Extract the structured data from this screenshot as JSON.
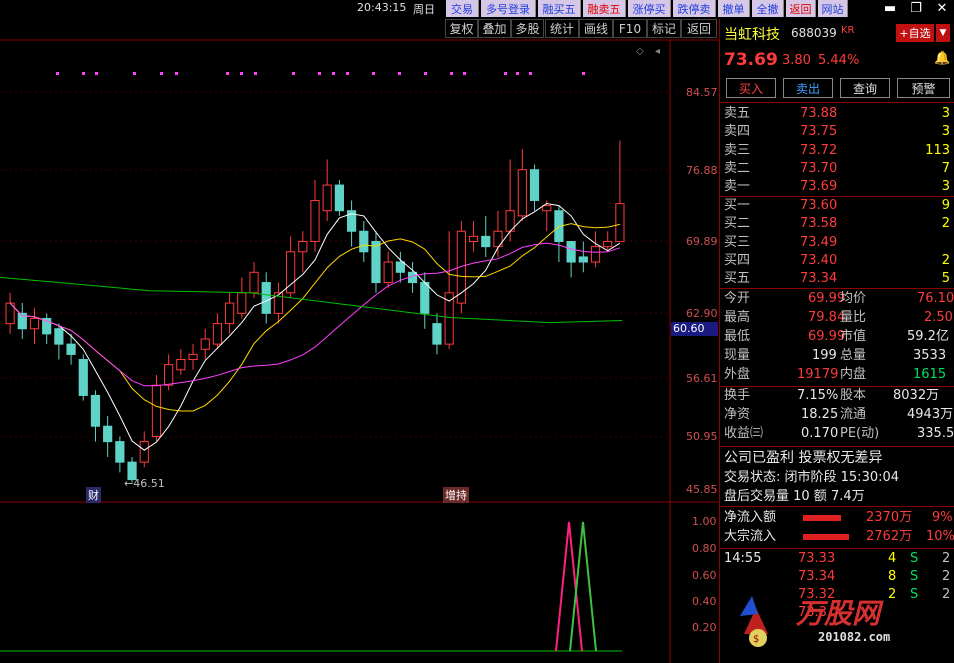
{
  "topbar": {
    "clock": "20:43:15",
    "weekday": "周日",
    "buttons": [
      "交易",
      "多号登录",
      "融买五",
      "融卖五",
      "涨停买",
      "跌停卖",
      "撤单",
      "全撤",
      "返回",
      "网站"
    ],
    "window_controls": [
      "▬",
      "❐",
      "✕"
    ]
  },
  "toolbar": {
    "buttons": [
      "复权",
      "叠加",
      "多股",
      "统计",
      "画线",
      "F10",
      "标记",
      "返回"
    ]
  },
  "chart": {
    "price_ticks": [
      "84.57",
      "76.88",
      "69.89",
      "62.90",
      "56.61",
      "50.95",
      "45.85"
    ],
    "current_marker": "60.60",
    "low_label": "←46.51",
    "tag_cai": "财",
    "tag_zengchi": "增持",
    "sub_ticks": [
      "1.00",
      "0.80",
      "0.60",
      "0.40",
      "0.20"
    ]
  },
  "stock": {
    "name": "当虹科技",
    "code": "688039",
    "suffix": "KR",
    "add_fav": "+自选",
    "price": "73.69",
    "change": "3.80",
    "change_pct": "5.44%",
    "actions": [
      "买入",
      "卖出",
      "查询",
      "预警"
    ]
  },
  "order_book": {
    "sell": [
      {
        "label": "卖五",
        "price": "73.88",
        "vol": "3"
      },
      {
        "label": "卖四",
        "price": "73.75",
        "vol": "3"
      },
      {
        "label": "卖三",
        "price": "73.72",
        "vol": "113"
      },
      {
        "label": "卖二",
        "price": "73.70",
        "vol": "7"
      },
      {
        "label": "卖一",
        "price": "73.69",
        "vol": "3"
      }
    ],
    "buy": [
      {
        "label": "买一",
        "price": "73.60",
        "vol": "9"
      },
      {
        "label": "买二",
        "price": "73.58",
        "vol": "2"
      },
      {
        "label": "买三",
        "price": "73.49",
        "vol": ""
      },
      {
        "label": "买四",
        "price": "73.40",
        "vol": "2"
      },
      {
        "label": "买五",
        "price": "73.34",
        "vol": "5"
      }
    ]
  },
  "stats": {
    "open_l": "今开",
    "open": "69.99",
    "avg_l": "均价",
    "avg": "76.10",
    "high_l": "最高",
    "high": "79.84",
    "ratio_l": "量比",
    "ratio": "2.50",
    "low_l": "最低",
    "low": "69.99",
    "mcap_l": "市值",
    "mcap": "59.2亿",
    "cur_l": "现量",
    "cur": "199",
    "total_l": "总量",
    "total": "3533",
    "out_l": "外盘",
    "out": "19179",
    "in_l": "内盘",
    "in": "1615",
    "turn_l": "换手",
    "turn": "7.15%",
    "shares_l": "股本",
    "shares": "8032万",
    "nav_l": "净资",
    "nav": "18.25",
    "float_l": "流通",
    "float": "4943万",
    "eps_l": "收益㈢",
    "eps": "0.170",
    "pe_l": "PE(动)",
    "pe": "335.5"
  },
  "info": {
    "line1": "公司已盈利 投票权无差异",
    "line2": "交易状态: 闭市阶段 15:30:04",
    "line3": "盘后交易量 10 额 7.4万",
    "net_inflow_l": "净流入额",
    "net_inflow": "2370万",
    "net_inflow_pct": "9%",
    "big_inflow_l": "大宗流入",
    "big_inflow": "2762万",
    "big_inflow_pct": "10%"
  },
  "ticks": [
    {
      "time": "14:55",
      "price": "73.33",
      "vol": "4",
      "side": "S",
      "n": "2"
    },
    {
      "time": "",
      "price": "73.34",
      "vol": "8",
      "side": "S",
      "n": "2"
    },
    {
      "time": "",
      "price": "73.32",
      "vol": "2",
      "side": "S",
      "n": "2"
    },
    {
      "time": "",
      "price": "73.3",
      "vol": "",
      "side": "",
      "n": ""
    }
  ],
  "watermark": {
    "brand": "万股网",
    "url": "201082.com"
  },
  "colors": {
    "up": "#ff3b3b",
    "down": "#5fd3c8",
    "ma5": "#ffffff",
    "ma10": "#ffd700",
    "ma20": "#ff40ff",
    "ma60": "#00c000"
  }
}
